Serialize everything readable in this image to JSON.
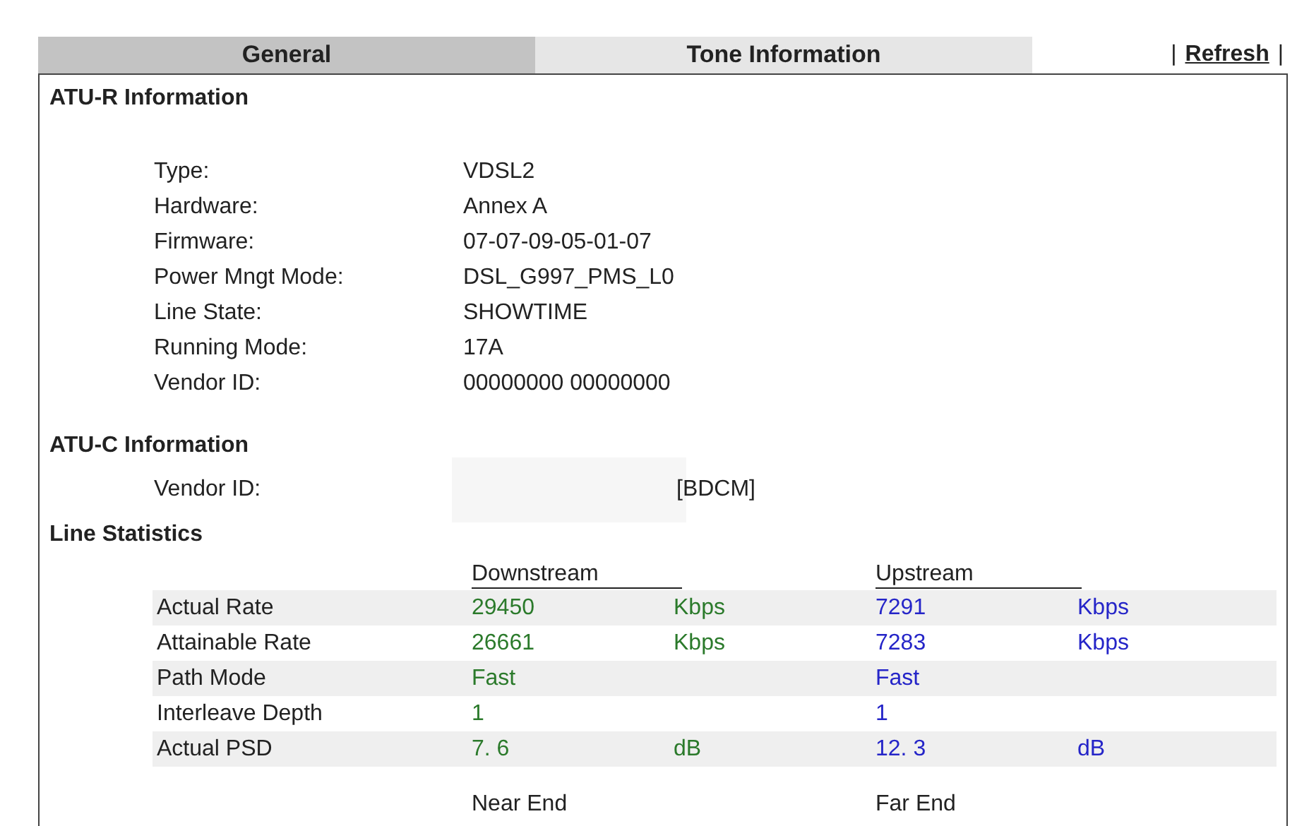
{
  "tabs": [
    {
      "label": "General",
      "selected": true
    },
    {
      "label": "Tone Information",
      "selected": false
    }
  ],
  "refresh": {
    "separator_left": "|",
    "label": "Refresh",
    "separator_right": "|"
  },
  "atu_r": {
    "title": "ATU-R Information",
    "fields": [
      {
        "label": "Type:",
        "value": "VDSL2"
      },
      {
        "label": "Hardware:",
        "value": "Annex A"
      },
      {
        "label": "Firmware:",
        "value": "07-07-09-05-01-07"
      },
      {
        "label": "Power Mngt Mode:",
        "value": "DSL_G997_PMS_L0"
      },
      {
        "label": "Line State:",
        "value": "SHOWTIME"
      },
      {
        "label": "Running Mode:",
        "value": "17A"
      },
      {
        "label": "Vendor ID:",
        "value": "00000000 00000000"
      }
    ]
  },
  "atu_c": {
    "title": "ATU-C Information",
    "fields": [
      {
        "label": "Vendor ID:",
        "value": "[BDCM]",
        "redacted": true
      }
    ]
  },
  "line_statistics": {
    "title": "Line Statistics",
    "downstream_header": "Downstream",
    "upstream_header": "Upstream",
    "rows": [
      {
        "label": "Actual Rate",
        "down": "29450",
        "down_unit": "Kbps",
        "up": "7291",
        "up_unit": "Kbps"
      },
      {
        "label": "Attainable Rate",
        "down": "26661",
        "down_unit": "Kbps",
        "up": "7283",
        "up_unit": "Kbps"
      },
      {
        "label": "Path Mode",
        "down": "Fast",
        "up": "Fast"
      },
      {
        "label": "Interleave Depth",
        "down": "1",
        "up": "1"
      },
      {
        "label": "Actual PSD",
        "down": "7. 6",
        "down_unit": "dB",
        "up": "12. 3",
        "up_unit": "dB"
      }
    ],
    "near_end_header": "Near End",
    "far_end_header": "Far End"
  }
}
